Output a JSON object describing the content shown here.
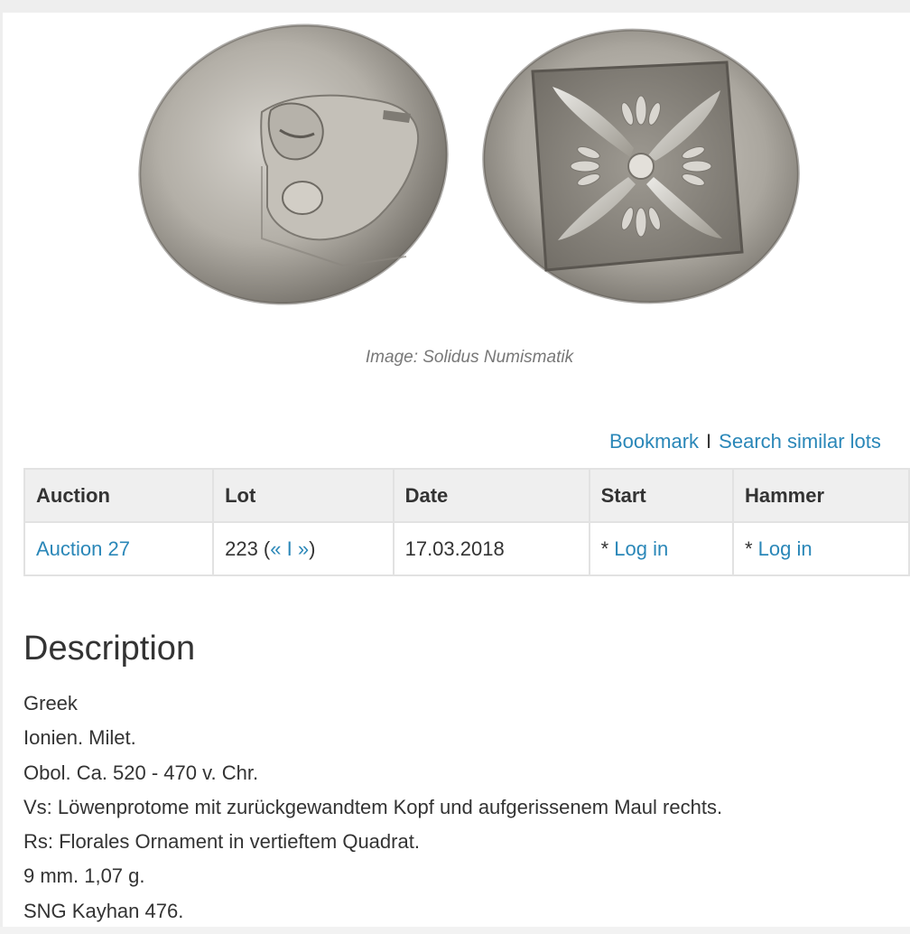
{
  "image": {
    "caption": "Image: Solidus Numismatik"
  },
  "actions": {
    "bookmark": "Bookmark",
    "separator": "I",
    "search_similar": "Search similar lots"
  },
  "table": {
    "headers": [
      "Auction",
      "Lot",
      "Date",
      "Start",
      "Hammer"
    ],
    "row": {
      "auction": "Auction 27",
      "lot_number": "223 (",
      "lot_prev": "«",
      "lot_sep": " I ",
      "lot_next": "»",
      "lot_close": ")",
      "date": "17.03.2018",
      "start_prefix": "* ",
      "start_link": "Log in",
      "hammer_prefix": "* ",
      "hammer_link": "Log in"
    }
  },
  "description": {
    "title": "Description",
    "lines": [
      "Greek",
      "Ionien. Milet.",
      "Obol. Ca. 520 - 470 v. Chr.",
      "Vs: Löwenprotome mit zurückgewandtem Kopf und aufgerissenem Maul rechts.",
      "Rs: Florales Ornament in vertieftem Quadrat.",
      "9 mm. 1,07 g.",
      "SNG Kayhan 476."
    ]
  }
}
